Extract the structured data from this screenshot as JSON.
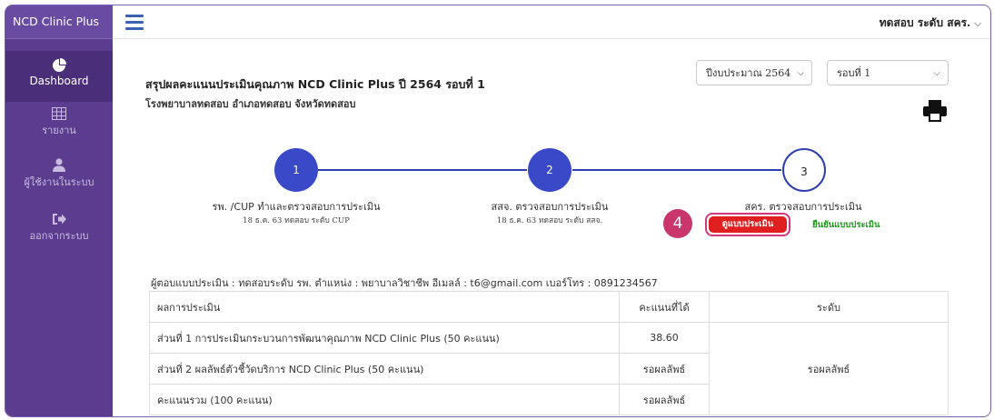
{
  "app": {
    "brand": "NCD Clinic Plus"
  },
  "sidebar": {
    "items": [
      {
        "label": "Dashboard",
        "icon": "pie-chart-icon"
      },
      {
        "label": "รายงาน",
        "icon": "table-icon"
      },
      {
        "label": "ผู้ใช้งานในระบบ",
        "icon": "user-icon"
      },
      {
        "label": "ออกจากระบบ",
        "icon": "logout-icon"
      }
    ]
  },
  "topbar": {
    "user_label": "ทดสอบ ระดับ สคร.",
    "menu_icon": "hamburger-icon"
  },
  "header": {
    "title": "สรุปผลคะแนนประเมินคุณภาพ NCD Clinic Plus ปี 2564 รอบที่ 1",
    "subtitle": "โรงพยาบาลทดสอบ อำเภอทดสอบ จังหวัดทดสอบ",
    "year_select": "ปีงบประมาณ 2564",
    "round_select": "รอบที่ 1",
    "print_icon": "printer-icon"
  },
  "steps": [
    {
      "number": "1",
      "label": "รพ. /CUP ทำและตรวจสอบการประเมิน",
      "sub": "18 ธ.ค. 63 ทดสอบ ระดับ CUP"
    },
    {
      "number": "2",
      "label": "สสจ. ตรวจสอบการประเมิน",
      "sub": "18 ธ.ค. 63 ทดสอบ ระดับ สสจ."
    },
    {
      "number": "3",
      "label": "สคร. ตรวจสอบการประเมิน",
      "button": "ดูแบบประเมิน",
      "link": "ยืนยันแบบประเมิน"
    }
  ],
  "callout": {
    "number": "4",
    "color": "#c8366b"
  },
  "respondent": "ผู้ตอบแบบประเมิน : ทดสอบระดับ รพ. ตำแหน่ง : พยาบาลวิชาชีพ อีเมลล์ : t6@gmail.com เบอร์โทร : 0891234567",
  "table": {
    "headers": [
      "ผลการประเมิน",
      "คะแนนที่ได้",
      "ระดับ"
    ],
    "rows": [
      {
        "item": "ส่วนที่ 1 การประเมินกระบวนการพัฒนาคุณภาพ NCD Clinic Plus (50 คะแนน)",
        "score": "38.60"
      },
      {
        "item": "ส่วนที่ 2 ผลลัพธ์ตัวชี้วัดบริการ NCD Clinic Plus (50 คะแนน)",
        "score": "รอผลลัพธ์"
      },
      {
        "item": "คะแนนรวม (100 คะแนน)",
        "score": "รอผลลัพธ์"
      }
    ],
    "level": "รอผลลัพธ์"
  },
  "colors": {
    "sidebar": "#5b3c8e",
    "step_done": "#3a49c8",
    "button": "#e02020",
    "confirm": "#1a9a1a"
  }
}
